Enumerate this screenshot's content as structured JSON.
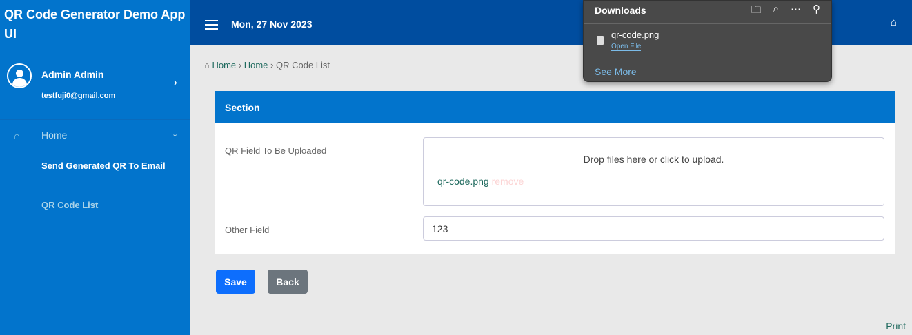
{
  "sidebar": {
    "brand": "QR Code Generator Demo App UI",
    "user_name": "Admin Admin",
    "user_email": "testfuji0@gmail.com",
    "nav": {
      "home": "Home",
      "items": [
        "Send Generated QR To Email",
        "QR Code List"
      ]
    }
  },
  "topbar": {
    "date": "Mon, 27 Nov 2023"
  },
  "breadcrumb": [
    "Home",
    "Home",
    "QR Code List"
  ],
  "card": {
    "title": "Section",
    "field1_label": "QR Field To Be Uploaded",
    "dropzone_msg": "Drop files here or click to upload.",
    "file_name": "qr-code.png",
    "remove": "remove",
    "field2_label": "Other Field",
    "field2_value": "123"
  },
  "buttons": {
    "save": "Save",
    "back": "Back"
  },
  "print": "Print",
  "downloads": {
    "title": "Downloads",
    "file": "qr-code.png",
    "open": "Open File",
    "see_more": "See More"
  }
}
